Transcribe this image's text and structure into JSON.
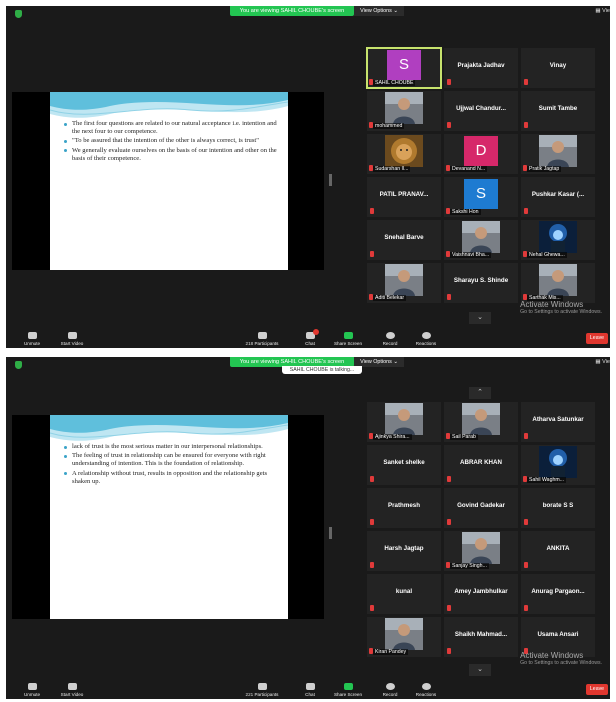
{
  "colors": {
    "panel_bg": "#1a1a1a",
    "tile_bg": "#232323",
    "share_green": "#23c552",
    "leave_red": "#e0372f",
    "active_border": "#c7e36d",
    "mute_red": "#e03a3a"
  },
  "shared": {
    "banner": "You are viewing SAHIL CHOUBE's screen",
    "view_options": "View Options ⌄",
    "view_label": "Vie",
    "talking": "SAHIL CHOUBE is talking...",
    "activate_title": "Activate Windows",
    "activate_sub": "Go to Settings to activate Windows."
  },
  "toolbar": {
    "unmute": "Unmute",
    "start_video": "Start Video",
    "participants": "Participants",
    "chat": "Chat",
    "share_screen": "Share Screen",
    "record": "Record",
    "reactions": "Reactions",
    "leave": "Leave"
  },
  "panel1": {
    "participants_count": "218",
    "slide_bullets": [
      "The first four questions are related to our natural acceptance i.e. intention and the next four to our competence.",
      "\"To be assured that the intention of the other is always correct, is trust\"",
      "We generally evaluate ourselves on the basis of our intention and other on the basis of their competence."
    ],
    "tiles": [
      {
        "type": "avatar",
        "letter": "S",
        "color": "#b03fc0",
        "label": "SAHIL CHOUBE",
        "active": true
      },
      {
        "type": "name",
        "name": "Prajakta Jadhav"
      },
      {
        "type": "name",
        "name": "Vinay"
      },
      {
        "type": "photo",
        "photo": "person-icon",
        "label": "mohammed"
      },
      {
        "type": "name",
        "name": "Ujjwal Chandur..."
      },
      {
        "type": "name",
        "name": "Sumit Tambe"
      },
      {
        "type": "photo",
        "photo": "lion-icon",
        "label": "Sudarshan Il..."
      },
      {
        "type": "avatar",
        "letter": "D",
        "color": "#d6286a",
        "label": "Devanand N..."
      },
      {
        "type": "photo",
        "photo": "person-icon",
        "label": "Pratik Jagtap"
      },
      {
        "type": "name",
        "name": "PATIL PRANAV..."
      },
      {
        "type": "avatar",
        "letter": "S",
        "color": "#1e7bd1",
        "label": "Sakshi Hon"
      },
      {
        "type": "name",
        "name": "Pushkar Kasar (..."
      },
      {
        "type": "name",
        "name": "Snehal Barve"
      },
      {
        "type": "photo",
        "photo": "person-icon",
        "label": "Vaishnavi Bha..."
      },
      {
        "type": "photo",
        "photo": "glow-icon",
        "label": "Nehal Ghewa..."
      },
      {
        "type": "photo",
        "photo": "person-icon",
        "label": "Aditi Belekar"
      },
      {
        "type": "name",
        "name": "Sharayu S. Shinde"
      },
      {
        "type": "photo",
        "photo": "person-icon",
        "label": "Sarthak Mis..."
      }
    ]
  },
  "panel2": {
    "participants_count": "221",
    "slide_bullets": [
      "lack of trust is the most serious matter in our interpersonal relationships.",
      "The feeling of trust in relationship can be ensured for everyone with right understanding of intention. This is the foundation of relationship.",
      "A relationship without trust, results in opposition and the relationship gets shaken up."
    ],
    "tiles": [
      {
        "type": "photo",
        "photo": "person-icon",
        "label": "Ajinkya Shira..."
      },
      {
        "type": "photo",
        "photo": "person-icon",
        "label": "Sail Parab"
      },
      {
        "type": "name",
        "name": "Atharva Satunkar"
      },
      {
        "type": "name",
        "name": "Sanket shelke"
      },
      {
        "type": "name",
        "name": "ABRAR KHAN"
      },
      {
        "type": "photo",
        "photo": "glow-icon",
        "label": "Sahil Waghm..."
      },
      {
        "type": "name",
        "name": "Prathmesh"
      },
      {
        "type": "name",
        "name": "Govind Gadekar"
      },
      {
        "type": "name",
        "name": "borate S S"
      },
      {
        "type": "name",
        "name": "Harsh Jagtap"
      },
      {
        "type": "photo",
        "photo": "person-icon",
        "label": "Sanjay Singh..."
      },
      {
        "type": "name",
        "name": "ANKITA"
      },
      {
        "type": "name",
        "name": "kunal"
      },
      {
        "type": "name",
        "name": "Amey Jambhulkar"
      },
      {
        "type": "name",
        "name": "Anurag Pargaon..."
      },
      {
        "type": "photo",
        "photo": "person-icon",
        "label": "Kiran Pandey"
      },
      {
        "type": "name",
        "name": "Shaikh Mahmad..."
      },
      {
        "type": "name",
        "name": "Usama Ansari"
      }
    ]
  }
}
